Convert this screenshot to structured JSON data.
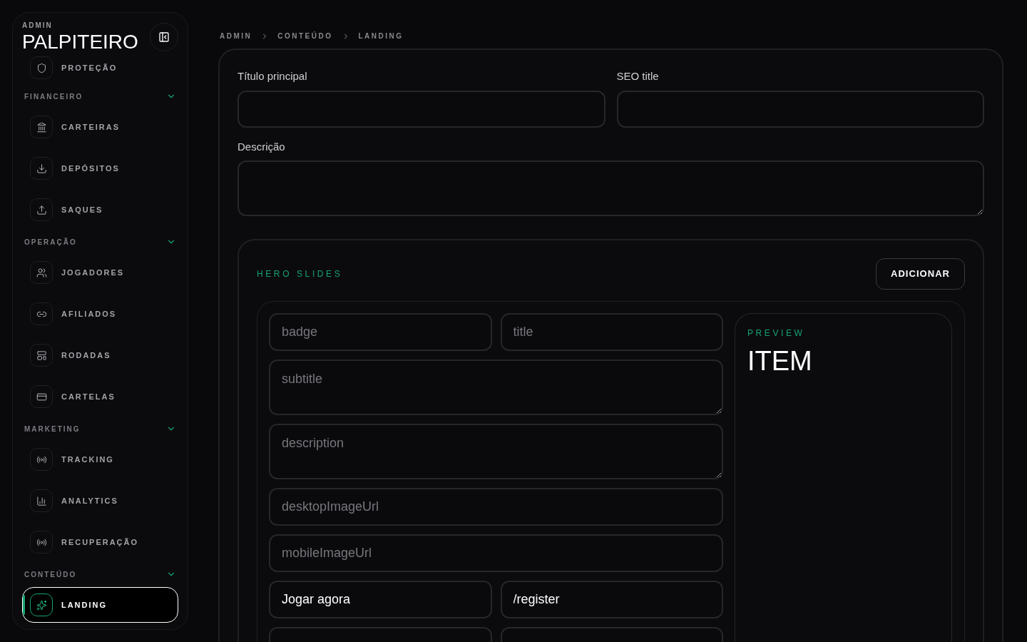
{
  "sidebar": {
    "overline": "ADMIN",
    "brand": "PALPITEIRO",
    "top_items": [
      {
        "label": "PROTEÇÃO",
        "selected": false
      }
    ],
    "sections": [
      {
        "title": "FINANCEIRO",
        "expanded": true,
        "items": [
          {
            "label": "CARTEIRAS",
            "selected": false
          },
          {
            "label": "DEPÓSITOS",
            "selected": false
          },
          {
            "label": "SAQUES",
            "selected": false
          }
        ]
      },
      {
        "title": "OPERAÇÃO",
        "expanded": true,
        "items": [
          {
            "label": "JOGADORES",
            "selected": false
          },
          {
            "label": "AFILIADOS",
            "selected": false
          },
          {
            "label": "RODADAS",
            "selected": false
          },
          {
            "label": "CARTELAS",
            "selected": false
          }
        ]
      },
      {
        "title": "MARKETING",
        "expanded": true,
        "items": [
          {
            "label": "TRACKING",
            "selected": false
          },
          {
            "label": "ANALYTICS",
            "selected": false
          },
          {
            "label": "RECUPERAÇÃO",
            "selected": false
          }
        ]
      },
      {
        "title": "CONTEÚDO",
        "expanded": true,
        "items": [
          {
            "label": "LANDING",
            "selected": true
          }
        ]
      }
    ]
  },
  "breadcrumb": [
    "ADMIN",
    "CONTEÚDO",
    "LANDING"
  ],
  "form": {
    "fields": [
      {
        "label": "Título principal"
      },
      {
        "label": "SEO title"
      }
    ],
    "description": {
      "label": "Descrição"
    }
  },
  "hero": {
    "title": "HERO SLIDES",
    "add_button": "ADICIONAR",
    "slide": {
      "fields": [
        {
          "kind": "input",
          "placeholder": "badge",
          "half": true
        },
        {
          "kind": "input",
          "placeholder": "title",
          "half": true
        },
        {
          "kind": "textarea",
          "placeholder": "subtitle"
        },
        {
          "kind": "textarea",
          "placeholder": "description"
        },
        {
          "kind": "input",
          "placeholder": "desktopImageUrl"
        },
        {
          "kind": "input",
          "placeholder": "mobileImageUrl"
        },
        {
          "kind": "input",
          "value": "Jogar agora",
          "half": true
        },
        {
          "kind": "input",
          "value": "/register",
          "half": true
        },
        {
          "kind": "input",
          "half": true
        },
        {
          "kind": "input",
          "half": true
        }
      ],
      "preview": {
        "label": "PREVIEW",
        "title": "ITEM"
      }
    }
  }
}
